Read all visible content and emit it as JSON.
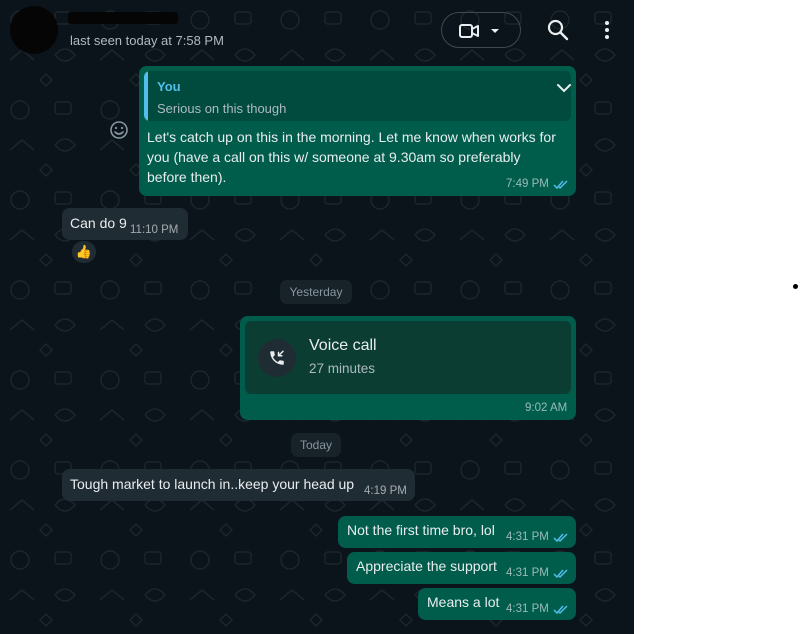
{
  "contact": {
    "last_seen": "last seen today at 7:58 PM"
  },
  "icons": {
    "video": "video-camera-icon",
    "dropdown": "chevron-down-icon",
    "search": "search-icon",
    "menu": "more-vertical-icon",
    "emoji": "emoji-icon",
    "call": "incoming-call-icon",
    "read": "double-check-icon"
  },
  "colors": {
    "chat_background": "#0b141a",
    "outgoing_bubble": "#005c4b",
    "incoming_bubble": "#202c33",
    "read_ticks": "#53bdeb",
    "quote_accent": "#53bdeb"
  },
  "messages": {
    "m1": {
      "quote_author": "You",
      "quote_text": "Serious on this though",
      "line1": "Let's catch up on this in the morning. Let me know when works for",
      "line2": "you (have a call on this w/ someone at 9.30am so preferably",
      "line3": "before then).",
      "time": "7:49 PM"
    },
    "m2": {
      "text": "Can do 9",
      "time": "11:10 PM",
      "reaction": "👍"
    },
    "date_yesterday": "Yesterday",
    "call": {
      "title": "Voice call",
      "duration": "27 minutes",
      "time": "9:02 AM"
    },
    "date_today": "Today",
    "m3": {
      "text": "Tough market to launch in..keep your head up",
      "time": "4:19 PM"
    },
    "m4": {
      "text": "Not the first time bro, lol",
      "time": "4:31 PM"
    },
    "m5": {
      "text": "Appreciate the support",
      "time": "4:31 PM"
    },
    "m6": {
      "text": "Means a lot",
      "time": "4:31 PM"
    }
  }
}
